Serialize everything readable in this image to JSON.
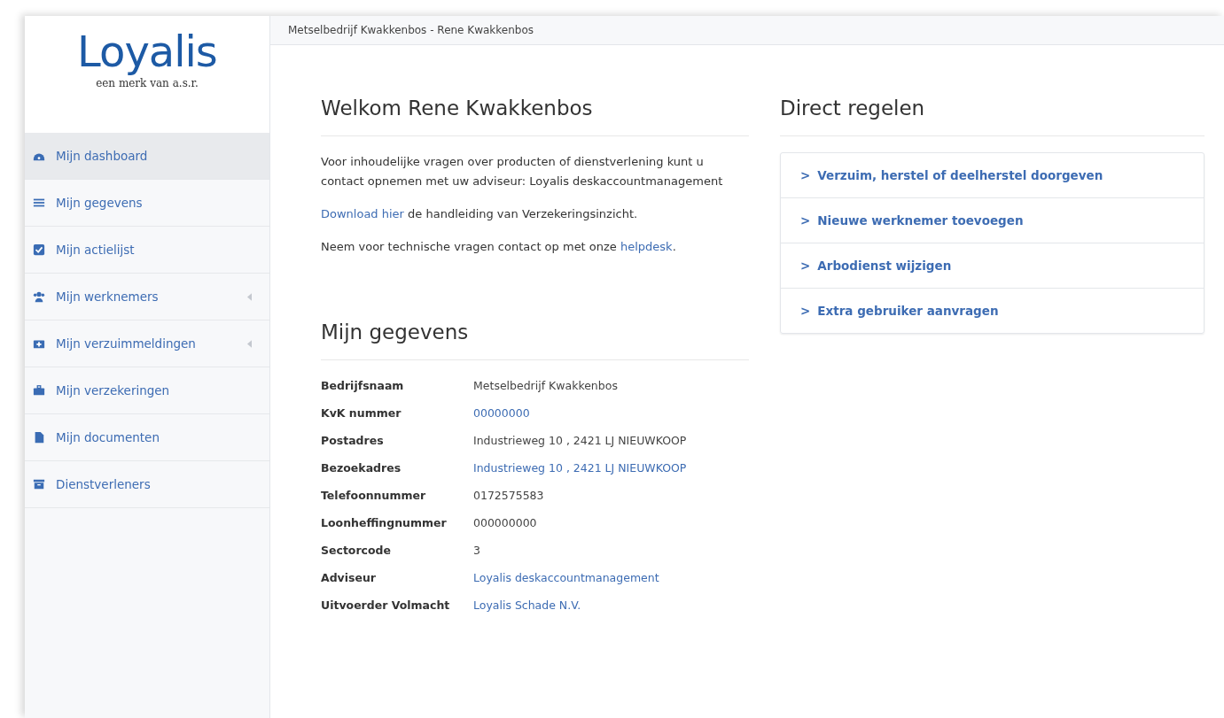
{
  "logo": {
    "name": "Loyalis",
    "tagline": "een merk van a.s.r."
  },
  "sidebar": {
    "items": [
      {
        "label": "Mijn dashboard",
        "selected": true,
        "has_submenu": false
      },
      {
        "label": "Mijn gegevens",
        "selected": false,
        "has_submenu": false
      },
      {
        "label": "Mijn actielijst",
        "selected": false,
        "has_submenu": false
      },
      {
        "label": "Mijn werknemers",
        "selected": false,
        "has_submenu": true
      },
      {
        "label": "Mijn verzuimmeldingen",
        "selected": false,
        "has_submenu": true
      },
      {
        "label": "Mijn verzekeringen",
        "selected": false,
        "has_submenu": false
      },
      {
        "label": "Mijn documenten",
        "selected": false,
        "has_submenu": false
      },
      {
        "label": "Dienstverleners",
        "selected": false,
        "has_submenu": false
      }
    ]
  },
  "header": {
    "breadcrumb": "Metselbedrijf Kwakkenbos - Rene Kwakkenbos"
  },
  "welcome": {
    "title": "Welkom Rene Kwakkenbos",
    "paragraphs": [
      [
        {
          "text": "Voor inhoudelijke vragen over producten of dienstverlening kunt u contact opnemen met uw adviseur: Loyalis deskaccountmanagement",
          "link": false
        }
      ],
      [
        {
          "text": "Download hier",
          "link": true
        },
        {
          "text": " de handleiding van Verzekeringsinzicht.",
          "link": false
        }
      ],
      [
        {
          "text": "Neem voor technische vragen contact op met onze ",
          "link": false
        },
        {
          "text": "helpdesk",
          "link": true
        },
        {
          "text": ".",
          "link": false
        }
      ]
    ]
  },
  "direct": {
    "title": "Direct regelen",
    "actions": [
      {
        "icon": ">",
        "label": "Verzuim, herstel of deelherstel doorgeven"
      },
      {
        "icon": ">",
        "label": "Nieuwe werknemer toevoegen"
      },
      {
        "icon": ">",
        "label": "Arbodienst wijzigen"
      },
      {
        "icon": ">",
        "label": "Extra gebruiker aanvragen"
      }
    ]
  },
  "details": {
    "title": "Mijn gegevens",
    "rows": [
      {
        "label": "Bedrijfsnaam",
        "value": "Metselbedrijf Kwakkenbos",
        "link": false
      },
      {
        "label": "KvK nummer",
        "value": "00000000",
        "link": true
      },
      {
        "label": "Postadres",
        "value": "Industrieweg 10 , 2421 LJ NIEUWKOOP",
        "link": false
      },
      {
        "label": "Bezoekadres",
        "value": "Industrieweg 10 , 2421 LJ NIEUWKOOP",
        "link": true
      },
      {
        "label": "Telefoonnummer",
        "value": "0172575583",
        "link": false
      },
      {
        "label": "Loonheffingnummer",
        "value": "000000000",
        "link": false
      },
      {
        "label": "Sectorcode",
        "value": "3",
        "link": false
      },
      {
        "label": "Adviseur",
        "value": "Loyalis deskaccountmanagement",
        "link": true
      },
      {
        "label": "Uitvoerder Volmacht",
        "value": "Loyalis Schade N.V.",
        "link": true
      }
    ]
  }
}
